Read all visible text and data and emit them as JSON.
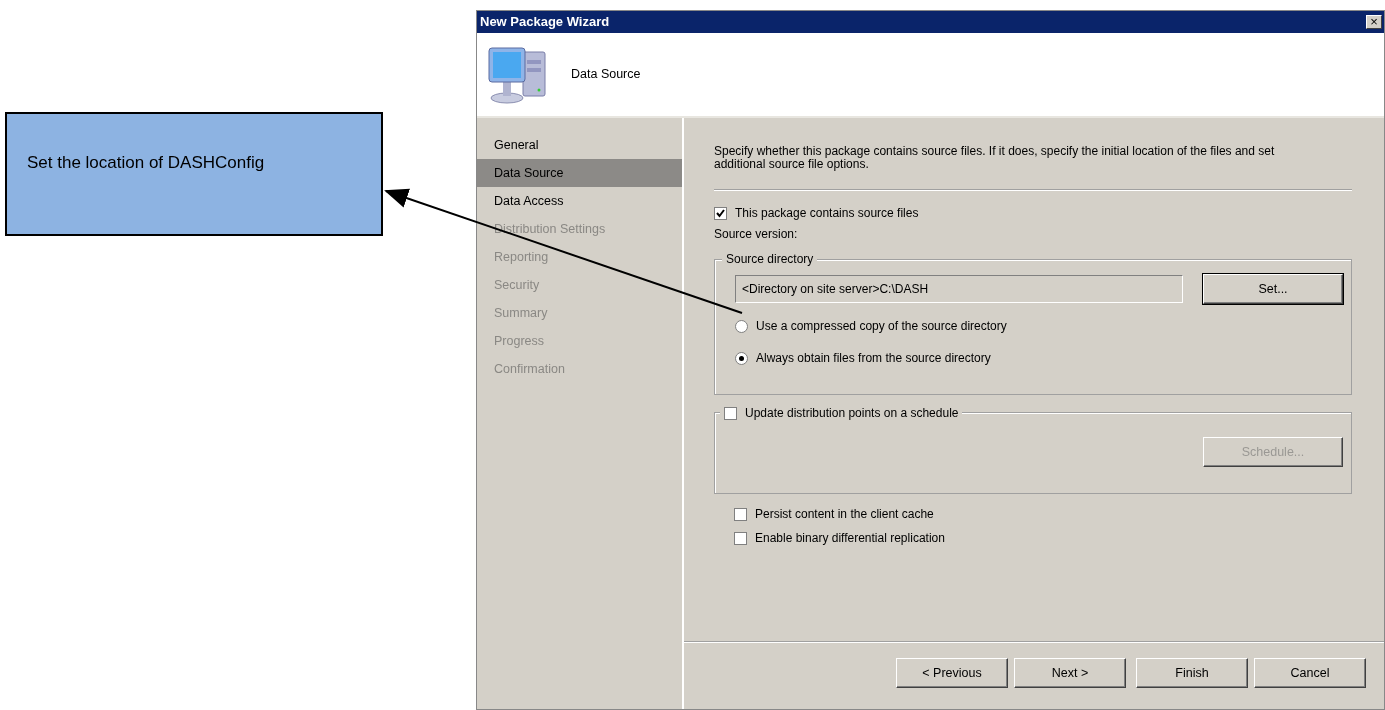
{
  "callout": {
    "text": "Set the location of DASHConfig"
  },
  "window": {
    "title": "New Package Wizard",
    "close": "×"
  },
  "header": {
    "title": "Data Source"
  },
  "steps": [
    {
      "label": "General",
      "selected": false,
      "disabled": false
    },
    {
      "label": "Data Source",
      "selected": true,
      "disabled": false
    },
    {
      "label": "Data Access",
      "selected": false,
      "disabled": false
    },
    {
      "label": "Distribution Settings",
      "selected": false,
      "disabled": true
    },
    {
      "label": "Reporting",
      "selected": false,
      "disabled": true
    },
    {
      "label": "Security",
      "selected": false,
      "disabled": true
    },
    {
      "label": "Summary",
      "selected": false,
      "disabled": true
    },
    {
      "label": "Progress",
      "selected": false,
      "disabled": true
    },
    {
      "label": "Confirmation",
      "selected": false,
      "disabled": true
    }
  ],
  "description": "Specify whether this package contains source files. If it does, specify the initial location of the files and set additional source file options.",
  "contains_source": {
    "label": "This package contains source files",
    "checked": true
  },
  "source_version_label": "Source version:",
  "source_directory": {
    "legend": "Source directory",
    "value": "<Directory on site server>C:\\DASH",
    "set_button": "Set...",
    "options": [
      {
        "label": "Use a compressed copy of the source directory",
        "selected": false
      },
      {
        "label": "Always obtain files from the source directory",
        "selected": true
      }
    ]
  },
  "schedule_group": {
    "label": "Update distribution points on a schedule",
    "checked": false,
    "button": "Schedule...",
    "button_disabled": true
  },
  "checkboxes": [
    {
      "label": "Persist content in the client cache",
      "checked": false
    },
    {
      "label": "Enable binary differential replication",
      "checked": false
    }
  ],
  "buttons": [
    "< Previous",
    "Next >",
    "Finish",
    "Cancel"
  ]
}
